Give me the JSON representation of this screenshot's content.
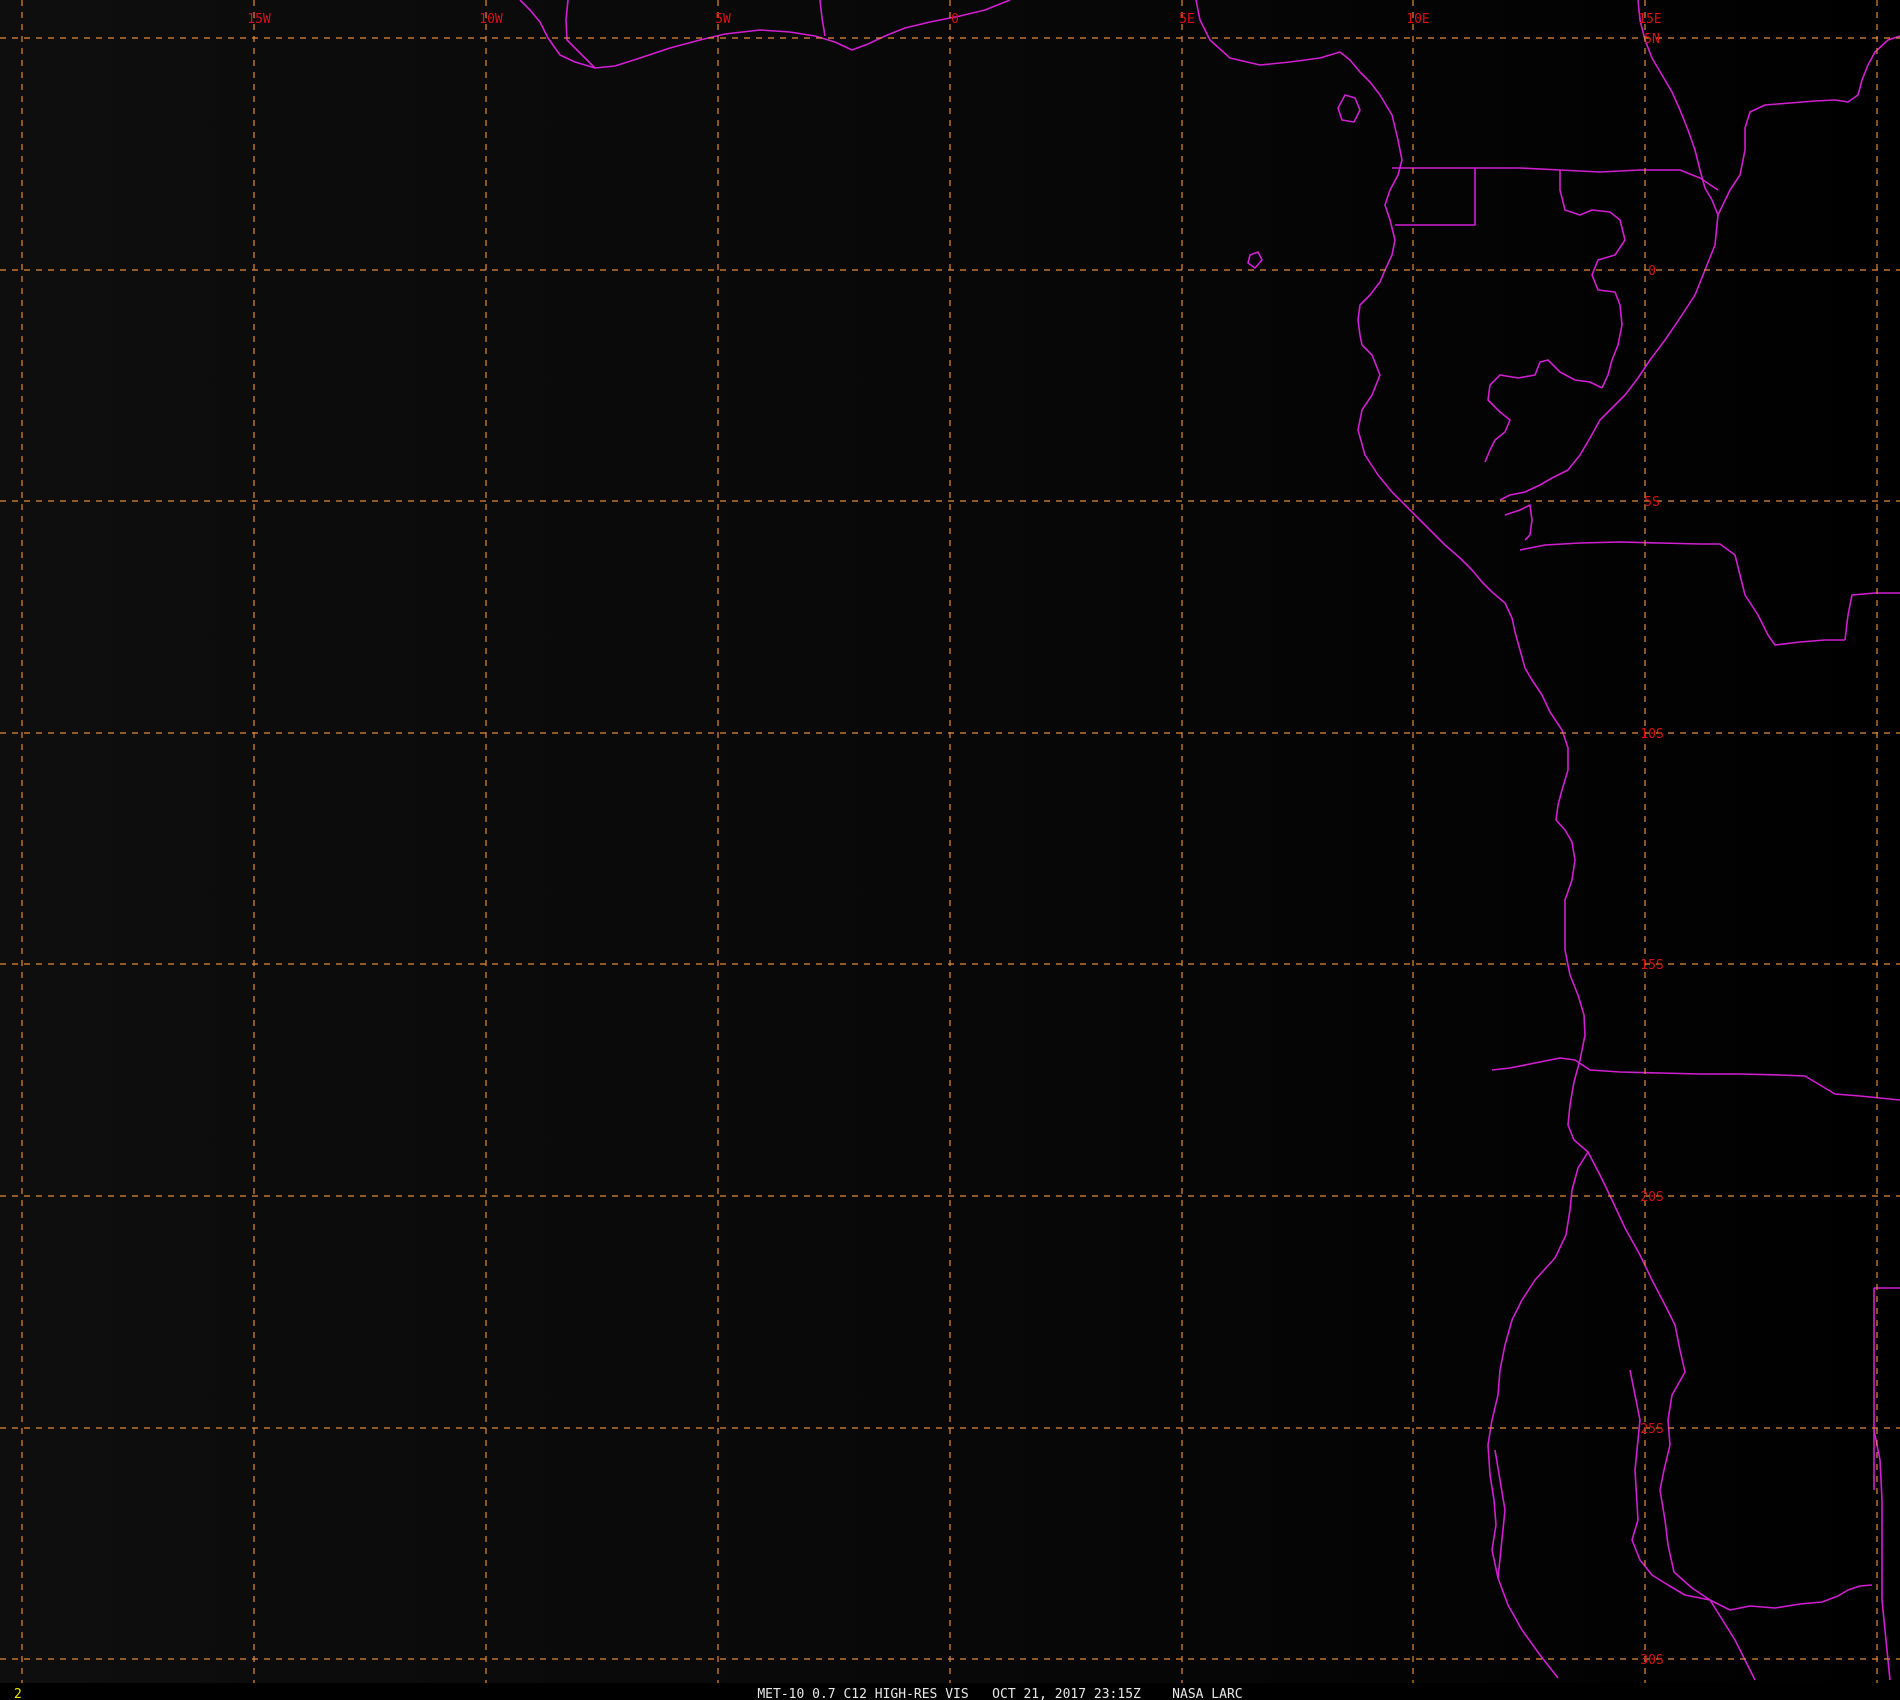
{
  "colors": {
    "background": "#000000",
    "ocean_shade": "#0b0b0b",
    "grid": "#e08a3a",
    "coast": "#d21ed2",
    "label": "#d81010",
    "footer": "#e8e8e8",
    "frame_number": "#e8e800"
  },
  "grid": {
    "longitude_labels": [
      "15W",
      "10W",
      "5W",
      "0",
      "5E",
      "10E",
      "15E"
    ],
    "latitude_labels": [
      "5N",
      "0",
      "5S",
      "10S",
      "15S",
      "20S",
      "25S",
      "30S"
    ]
  },
  "footer": {
    "frame_number": "2",
    "caption": "MET-10 0.7 C12 HIGH-RES VIS   OCT 21, 2017 23:15Z    NASA LARC"
  }
}
